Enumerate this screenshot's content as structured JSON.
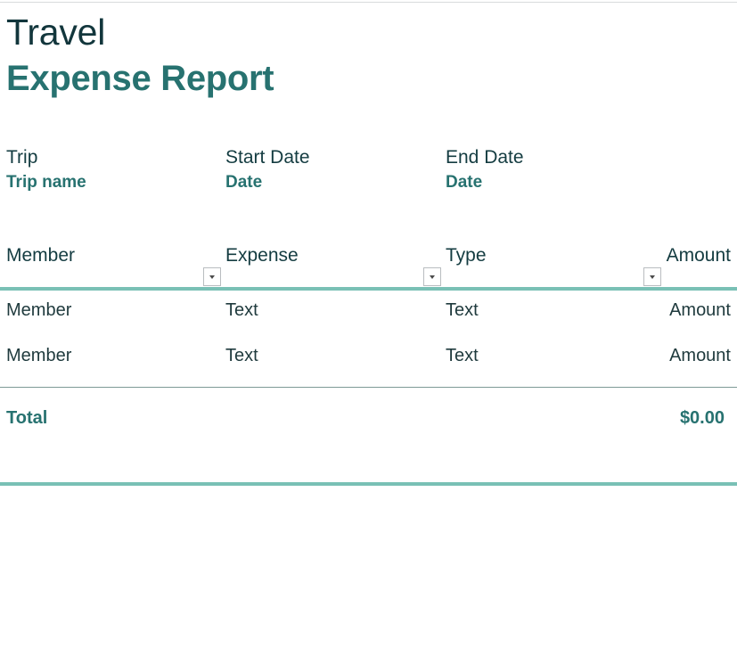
{
  "document": {
    "title_line1": "Travel",
    "title_line2": "Expense Report"
  },
  "trip_info": {
    "fields": [
      {
        "label": "Trip",
        "value": "Trip name"
      },
      {
        "label": "Start Date",
        "value": "Date"
      },
      {
        "label": "End Date",
        "value": "Date"
      }
    ]
  },
  "expense_table": {
    "columns": [
      "Member",
      "Expense",
      "Type",
      "Amount"
    ],
    "filters": [
      {
        "column": "Expense",
        "icon": "filter-dropdown-arrow-icon"
      },
      {
        "column": "Type",
        "icon": "filter-dropdown-arrow-icon"
      },
      {
        "column": "Amount",
        "icon": "filter-dropdown-arrow-icon"
      }
    ],
    "rows": [
      {
        "member": "Member",
        "expense": "Text",
        "type": "Text",
        "amount": "Amount"
      },
      {
        "member": "Member",
        "expense": "Text",
        "type": "Text",
        "amount": "Amount"
      }
    ],
    "total_label": "Total",
    "total_value": "$0.00"
  },
  "colors": {
    "accent_teal": "#277270",
    "rule_teal": "#79c0b5",
    "rule_gray": "#7d9a96",
    "heading_dark": "#12363c",
    "body_text": "#1f3a3d"
  }
}
